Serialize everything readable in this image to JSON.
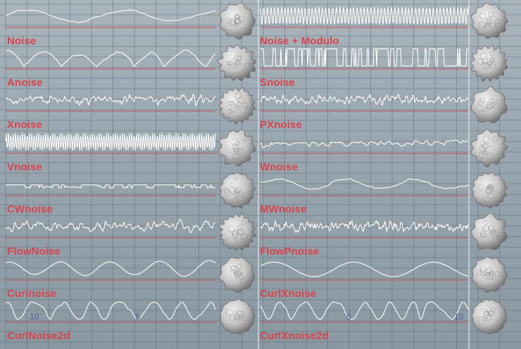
{
  "noise_labels": {
    "left": [
      "Noise",
      "Anoise",
      "Xnoise",
      "Vnoise",
      "CWnoise",
      "FlowNoise",
      "Curlnoise",
      "CurlNoise2d"
    ],
    "right": [
      "Noise + Modulo",
      "Snoise",
      "PXnoise",
      "Wnoise",
      "MWnoise",
      "FlowPnoise",
      "CurlXnoise",
      "CurlXnoise2d"
    ]
  },
  "axis_ticks": {
    "left": [
      "10",
      "5"
    ],
    "right": [
      "5",
      "10"
    ]
  },
  "colors": {
    "label": "#d8434c",
    "baseline": "#c9505a",
    "waveform": "#ffffff",
    "grid": "#55636d",
    "tick": "#4f5f9a",
    "sphere": "#c4c4c4"
  },
  "icons": [
    "noise-sphere-icon"
  ]
}
